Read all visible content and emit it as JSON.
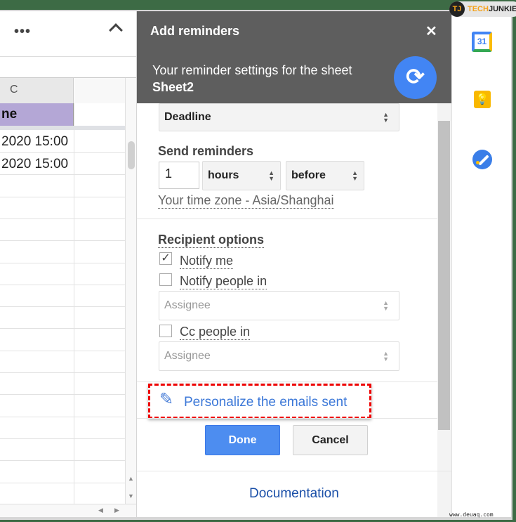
{
  "sheet": {
    "more_icon": "more-horizontal-icon",
    "collapse_icon": "chevron-up-icon",
    "column_header": "C",
    "header_cell": "ne",
    "header_color": "#b4a7d6",
    "rows": [
      "2020 15:00",
      "2020 15:00"
    ]
  },
  "dialog": {
    "title": "Add reminders",
    "close": "✕",
    "subtitle": "Your reminder settings for the sheet",
    "sheet_name": "Sheet2",
    "header_color": "#5e5e5e",
    "accent": "#4285f4",
    "deadline_select": "Deadline",
    "send_reminders_label": "Send reminders",
    "amount_value": "1",
    "unit_select": "hours",
    "relation_select": "before",
    "timezone": "Your time zone - Asia/Shanghai",
    "recipient_label": "Recipient options",
    "notify_me": {
      "label": "Notify me",
      "checked": true
    },
    "notify_people": {
      "label": "Notify people in",
      "checked": false
    },
    "notify_people_select": "Assignee",
    "cc_people": {
      "label": "Cc people in",
      "checked": false
    },
    "cc_people_select": "Assignee",
    "personalize_link": "Personalize the emails sent",
    "done": "Done",
    "cancel": "Cancel",
    "documentation": "Documentation"
  },
  "side_panel": {
    "calendar_day": "31",
    "icons": [
      "google-calendar-icon",
      "google-keep-icon",
      "google-tasks-icon"
    ]
  },
  "watermark": {
    "logo": "TECHJUNKIE",
    "url": "www.deuaq.com"
  }
}
